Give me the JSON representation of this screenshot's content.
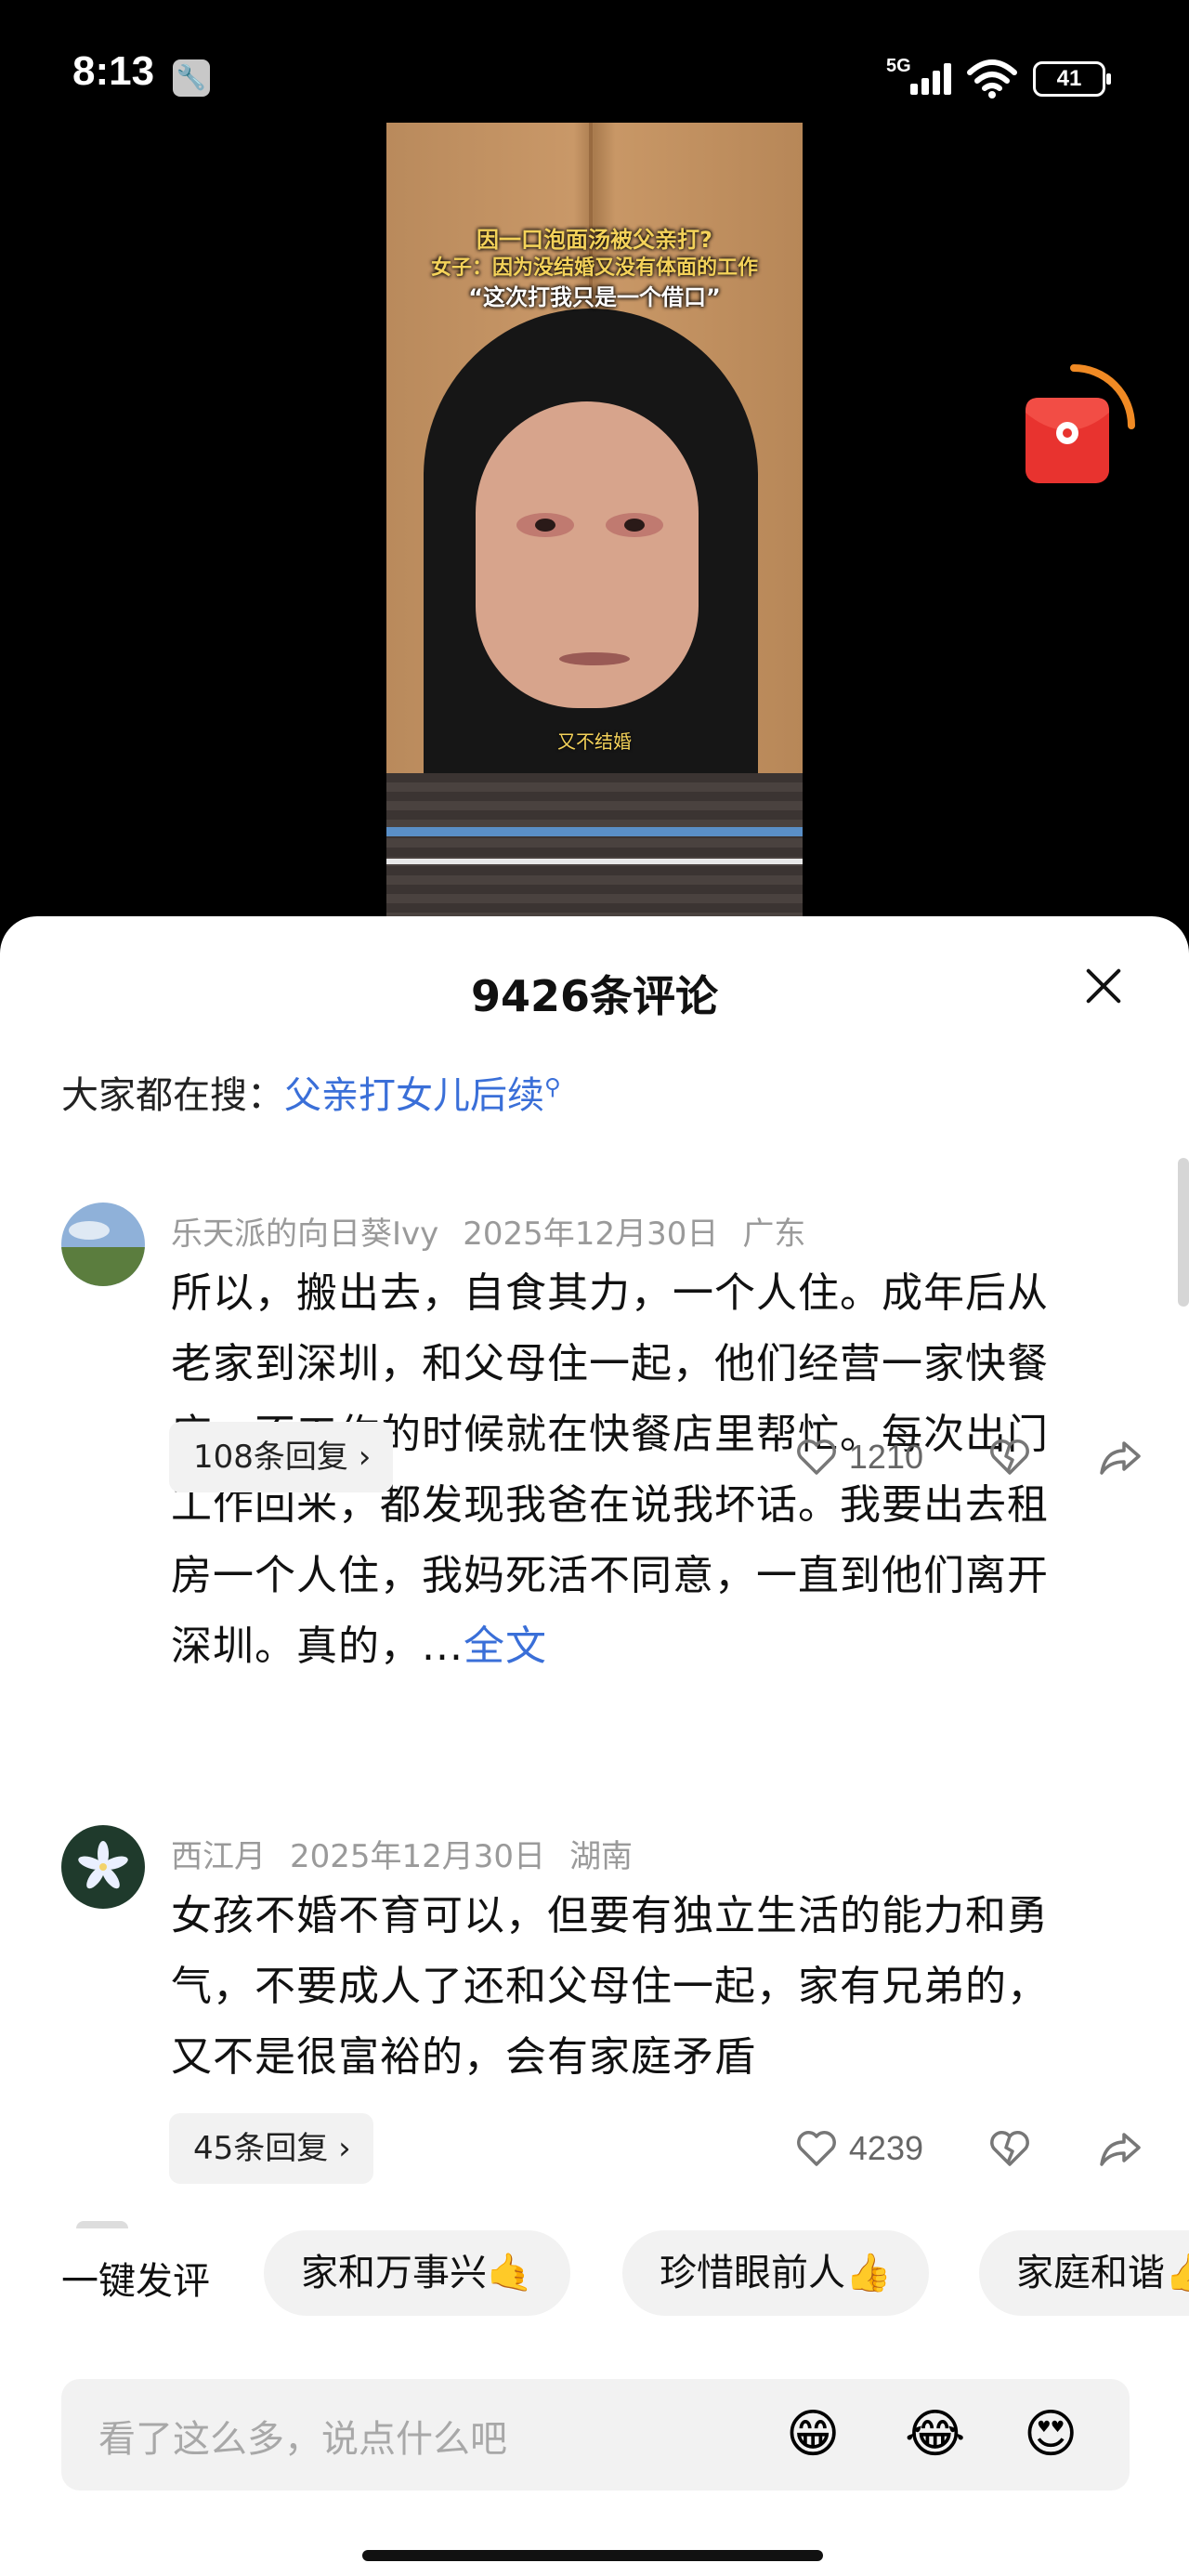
{
  "status_bar": {
    "time": "8:13",
    "network": "5G",
    "battery": "41"
  },
  "video": {
    "caption_line1": "因一口泡面汤被父亲打?",
    "caption_line2": "女子：因为没结婚又没有体面的工作",
    "caption_line3": "“这次打我只是一个借口”",
    "subtitle": "又不结婚"
  },
  "comments_panel": {
    "title": "9426条评论",
    "search_prefix": "大家都在搜：",
    "search_term": "父亲打女儿后续"
  },
  "comments": [
    {
      "author": "乐天派的向日葵Ivy",
      "date": "2025年12月30日",
      "location": "广东",
      "text": "所以，搬出去，自食其力，一个人住。成年后从老家到深圳，和父母住一起，他们经营一家快餐店。不工作的时候就在快餐店里帮忙。每次出门工作回来，都发现我爸在说我坏话。我要出去租房一个人住，我妈死活不同意，一直到他们离开深圳。真的，...",
      "more_label": "全文",
      "replies_label": "108条回复",
      "likes": "1210"
    },
    {
      "author": "西江月",
      "date": "2025年12月30日",
      "location": "湖南",
      "text": "女孩不婚不育可以，但要有独立生活的能力和勇气，不要成人了还和父母住一起，家有兄弟的，又不是很富裕的，会有家庭矛盾",
      "replies_label": "45条回复",
      "likes": "4239"
    }
  ],
  "quick_comments": {
    "label": "一键发评",
    "chips": [
      "家和万事兴🤙",
      "珍惜眼前人👍",
      "家庭和谐👍"
    ]
  },
  "input": {
    "placeholder": "看了这么多，说点什么吧"
  },
  "emojis": [
    "😁",
    "😂",
    "😍"
  ],
  "colors": {
    "accent": "#3a6fd8",
    "sheet_bg": "#ffffff",
    "chip_bg": "#f2f2f2"
  }
}
